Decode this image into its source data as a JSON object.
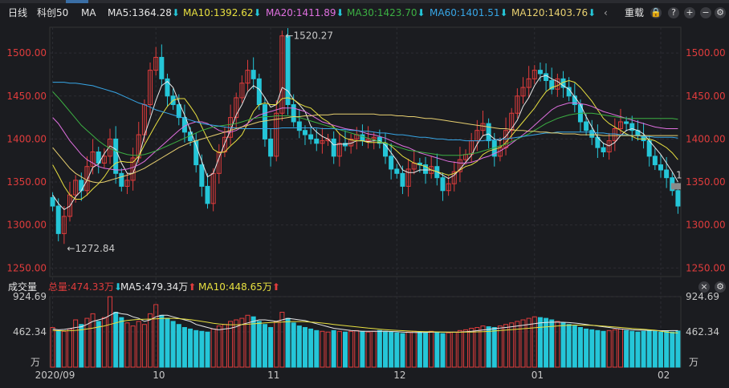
{
  "toolbar": {
    "period": "日线",
    "symbol": "科创50",
    "ma_label": "MA",
    "ma5": "MA5:1364.28",
    "ma10": "MA10:1392.62",
    "ma20": "MA20:1411.89",
    "ma30": "MA30:1423.70",
    "ma60": "MA60:1401.51",
    "ma120": "MA120:1403.76",
    "down_arrow": "⬇",
    "expand": "‹",
    "restore_label": "重载",
    "colors": {
      "ma5": "#e8e8e8",
      "ma10": "#e8e040",
      "ma20": "#e070e0",
      "ma30": "#3cb043",
      "ma60": "#37a6e6",
      "ma120": "#e8d070",
      "up": "#e03c3c",
      "down": "#25c6d8"
    }
  },
  "volume_bar": {
    "title": "成交量",
    "total": "总量:474.33万",
    "ma5": "MA5:479.34万",
    "ma10": "MA10:448.65万",
    "arrow_down": "⬇",
    "arrow_up": "⬆"
  },
  "chart_data": [
    {
      "type": "candlestick",
      "title": "科创50 日线",
      "y_ticks": [
        1250.0,
        1300.0,
        1350.0,
        1400.0,
        1450.0,
        1500.0
      ],
      "ylim": [
        1240,
        1530
      ],
      "annotations": [
        {
          "label": "←1520.27",
          "value": 1520.27
        },
        {
          "label": "←1272.84",
          "value": 1272.84
        }
      ],
      "right_marker": "1",
      "x_ticks": [
        "2020/09",
        "10",
        "11",
        "12",
        "01",
        "02"
      ],
      "x_tick_index": [
        0,
        18,
        38,
        60,
        84,
        106
      ],
      "closes": [
        1322,
        1290,
        1310,
        1335,
        1352,
        1340,
        1368,
        1385,
        1372,
        1380,
        1400,
        1360,
        1345,
        1352,
        1378,
        1405,
        1440,
        1480,
        1495,
        1470,
        1450,
        1440,
        1425,
        1408,
        1398,
        1370,
        1345,
        1325,
        1360,
        1385,
        1402,
        1425,
        1448,
        1465,
        1480,
        1470,
        1440,
        1400,
        1380,
        1430,
        1520,
        1440,
        1420,
        1410,
        1405,
        1400,
        1395,
        1398,
        1400,
        1380,
        1395,
        1392,
        1400,
        1405,
        1398,
        1400,
        1402,
        1395,
        1380,
        1365,
        1360,
        1345,
        1365,
        1372,
        1370,
        1360,
        1368,
        1355,
        1340,
        1348,
        1362,
        1376,
        1382,
        1398,
        1410,
        1418,
        1398,
        1380,
        1390,
        1410,
        1430,
        1450,
        1460,
        1470,
        1480,
        1476,
        1468,
        1458,
        1470,
        1460,
        1450,
        1440,
        1420,
        1410,
        1402,
        1390,
        1385,
        1398,
        1412,
        1420,
        1418,
        1410,
        1404,
        1398,
        1380,
        1370,
        1364,
        1355,
        1340,
        1322
      ],
      "ma_series": [
        {
          "name": "MA5",
          "values": [
            1335,
            1325,
            1318,
            1322,
            1333,
            1340,
            1352,
            1367,
            1371,
            1383,
            1392,
            1388,
            1372,
            1360,
            1360,
            1378,
            1404,
            1424,
            1445,
            1462,
            1467,
            1460,
            1443,
            1428,
            1410,
            1393,
            1374,
            1356,
            1360,
            1378,
            1395,
            1410,
            1428,
            1440,
            1455,
            1462,
            1458,
            1448,
            1437,
            1440,
            1460,
            1456,
            1446,
            1440,
            1432,
            1415,
            1408,
            1403,
            1400,
            1393,
            1394,
            1394,
            1395,
            1398,
            1398,
            1397,
            1398,
            1398,
            1393,
            1384,
            1375,
            1364,
            1361,
            1361,
            1364,
            1364,
            1364,
            1362,
            1358,
            1354,
            1358,
            1365,
            1373,
            1381,
            1394,
            1404,
            1406,
            1400,
            1398,
            1403,
            1412,
            1422,
            1438,
            1448,
            1462,
            1472,
            1474,
            1470,
            1467,
            1462,
            1458,
            1449,
            1440,
            1426,
            1414,
            1402,
            1395,
            1392,
            1396,
            1404,
            1410,
            1412,
            1410,
            1406,
            1398,
            1390,
            1382,
            1372,
            1362,
            1350
          ]
        },
        {
          "name": "MA10",
          "values": [
            1370,
            1358,
            1345,
            1335,
            1330,
            1330,
            1335,
            1342,
            1348,
            1356,
            1366,
            1372,
            1374,
            1373,
            1373,
            1380,
            1393,
            1405,
            1417,
            1428,
            1438,
            1445,
            1447,
            1447,
            1438,
            1428,
            1414,
            1400,
            1388,
            1384,
            1385,
            1392,
            1398,
            1405,
            1418,
            1432,
            1440,
            1442,
            1440,
            1440,
            1447,
            1448,
            1446,
            1441,
            1438,
            1436,
            1430,
            1424,
            1420,
            1414,
            1406,
            1401,
            1399,
            1398,
            1398,
            1396,
            1396,
            1396,
            1396,
            1392,
            1386,
            1380,
            1376,
            1372,
            1370,
            1368,
            1364,
            1362,
            1360,
            1358,
            1360,
            1364,
            1368,
            1370,
            1374,
            1382,
            1386,
            1388,
            1390,
            1396,
            1404,
            1412,
            1420,
            1428,
            1436,
            1446,
            1455,
            1460,
            1462,
            1466,
            1468,
            1466,
            1460,
            1452,
            1444,
            1434,
            1424,
            1418,
            1414,
            1410,
            1406,
            1403,
            1400,
            1400,
            1400,
            1398,
            1394,
            1390,
            1384,
            1376
          ]
        },
        {
          "name": "MA20",
          "values": [
            1425,
            1418,
            1408,
            1398,
            1390,
            1382,
            1376,
            1372,
            1368,
            1366,
            1365,
            1364,
            1364,
            1365,
            1367,
            1370,
            1374,
            1380,
            1386,
            1392,
            1398,
            1404,
            1410,
            1415,
            1418,
            1420,
            1420,
            1418,
            1414,
            1410,
            1408,
            1408,
            1410,
            1414,
            1418,
            1424,
            1428,
            1430,
            1432,
            1434,
            1436,
            1436,
            1436,
            1434,
            1432,
            1428,
            1424,
            1420,
            1418,
            1416,
            1414,
            1412,
            1411,
            1410,
            1408,
            1406,
            1405,
            1403,
            1401,
            1398,
            1395,
            1392,
            1390,
            1387,
            1384,
            1382,
            1380,
            1378,
            1376,
            1374,
            1373,
            1372,
            1372,
            1373,
            1375,
            1378,
            1380,
            1383,
            1386,
            1390,
            1395,
            1400,
            1405,
            1410,
            1416,
            1422,
            1428,
            1434,
            1438,
            1440,
            1442,
            1442,
            1441,
            1440,
            1438,
            1435,
            1432,
            1430,
            1428,
            1426,
            1424,
            1422,
            1420,
            1418,
            1416,
            1414,
            1413,
            1412,
            1412,
            1412
          ]
        },
        {
          "name": "MA30",
          "values": [
            1455,
            1448,
            1440,
            1432,
            1424,
            1416,
            1410,
            1404,
            1398,
            1393,
            1389,
            1386,
            1384,
            1382,
            1381,
            1381,
            1382,
            1384,
            1386,
            1389,
            1392,
            1395,
            1398,
            1401,
            1404,
            1407,
            1410,
            1412,
            1414,
            1415,
            1416,
            1417,
            1418,
            1420,
            1422,
            1424,
            1425,
            1426,
            1426,
            1427,
            1427,
            1427,
            1426,
            1425,
            1423,
            1421,
            1419,
            1417,
            1415,
            1413,
            1411,
            1409,
            1407,
            1405,
            1403,
            1401,
            1399,
            1397,
            1395,
            1393,
            1391,
            1389,
            1387,
            1386,
            1385,
            1384,
            1383,
            1382,
            1381,
            1381,
            1381,
            1381,
            1382,
            1383,
            1384,
            1386,
            1388,
            1390,
            1392,
            1394,
            1397,
            1400,
            1403,
            1406,
            1410,
            1414,
            1418,
            1421,
            1424,
            1426,
            1428,
            1429,
            1430,
            1430,
            1430,
            1429,
            1428,
            1427,
            1426,
            1425,
            1424,
            1424,
            1424,
            1424,
            1424,
            1424,
            1424,
            1424,
            1424,
            1423
          ]
        },
        {
          "name": "MA60",
          "values": [
            1466,
            1466,
            1466,
            1465,
            1465,
            1464,
            1463,
            1462,
            1460,
            1458,
            1456,
            1454,
            1451,
            1448,
            1445,
            1442,
            1440,
            1437,
            1434,
            1432,
            1430,
            1428,
            1426,
            1424,
            1422,
            1420,
            1418,
            1417,
            1416,
            1415,
            1414,
            1413,
            1413,
            1412,
            1412,
            1412,
            1412,
            1412,
            1412,
            1412,
            1413,
            1413,
            1413,
            1413,
            1413,
            1413,
            1413,
            1412,
            1412,
            1412,
            1411,
            1411,
            1410,
            1410,
            1409,
            1409,
            1408,
            1407,
            1407,
            1406,
            1405,
            1405,
            1404,
            1403,
            1402,
            1402,
            1401,
            1400,
            1400,
            1399,
            1399,
            1399,
            1398,
            1398,
            1398,
            1398,
            1399,
            1399,
            1400,
            1400,
            1401,
            1402,
            1403,
            1404,
            1405,
            1406,
            1407,
            1407,
            1408,
            1408,
            1408,
            1408,
            1408,
            1408,
            1408,
            1407,
            1407,
            1406,
            1406,
            1405,
            1405,
            1404,
            1404,
            1403,
            1403,
            1402,
            1402,
            1402,
            1402,
            1401
          ]
        },
        {
          "name": "MA120",
          "values": [
            1390,
            1382,
            1374,
            1366,
            1360,
            1356,
            1352,
            1350,
            1349,
            1350,
            1352,
            1354,
            1356,
            1358,
            1360,
            1363,
            1366,
            1370,
            1374,
            1378,
            1382,
            1386,
            1390,
            1393,
            1396,
            1398,
            1400,
            1402,
            1404,
            1406,
            1408,
            1410,
            1412,
            1414,
            1416,
            1418,
            1420,
            1421,
            1422,
            1423,
            1424,
            1425,
            1426,
            1426,
            1427,
            1427,
            1428,
            1428,
            1428,
            1429,
            1429,
            1429,
            1429,
            1429,
            1429,
            1429,
            1429,
            1428,
            1428,
            1428,
            1427,
            1427,
            1426,
            1426,
            1425,
            1424,
            1424,
            1423,
            1422,
            1421,
            1420,
            1419,
            1418,
            1417,
            1416,
            1415,
            1414,
            1413,
            1412,
            1412,
            1411,
            1410,
            1410,
            1409,
            1409,
            1408,
            1408,
            1407,
            1407,
            1406,
            1406,
            1406,
            1405,
            1405,
            1405,
            1405,
            1404,
            1404,
            1404,
            1404,
            1404,
            1404,
            1404,
            1404,
            1404,
            1404,
            1404,
            1404,
            1404,
            1404
          ]
        }
      ]
    },
    {
      "type": "bar",
      "title": "成交量",
      "y_ticks_labels": [
        "924.69",
        "462.34",
        "万"
      ],
      "y_ticks": [
        924.69,
        462.34
      ],
      "ylim": [
        0,
        924.69
      ],
      "values": [
        520,
        480,
        470,
        500,
        620,
        560,
        640,
        700,
        600,
        650,
        924,
        720,
        650,
        580,
        540,
        600,
        560,
        700,
        820,
        680,
        640,
        600,
        560,
        520,
        500,
        480,
        470,
        460,
        500,
        540,
        560,
        600,
        620,
        640,
        680,
        660,
        600,
        560,
        520,
        600,
        720,
        640,
        580,
        540,
        520,
        500,
        480,
        470,
        460,
        480,
        470,
        460,
        470,
        480,
        470,
        460,
        470,
        480,
        470,
        460,
        450,
        440,
        460,
        470,
        460,
        450,
        470,
        460,
        440,
        450,
        460,
        480,
        490,
        510,
        520,
        540,
        530,
        520,
        540,
        560,
        580,
        600,
        620,
        640,
        660,
        650,
        640,
        620,
        600,
        580,
        560,
        540,
        520,
        500,
        490,
        480,
        470,
        480,
        490,
        500,
        480,
        470,
        460,
        470,
        480,
        470,
        460,
        470,
        460,
        474
      ],
      "ma5": [
        500,
        490,
        495,
        505,
        520,
        530,
        560,
        600,
        620,
        640,
        680,
        720,
        700,
        690,
        660,
        640,
        600,
        620,
        660,
        680,
        680,
        660,
        640,
        620,
        600,
        560,
        540,
        520,
        500,
        490,
        500,
        510,
        530,
        560,
        580,
        600,
        620,
        620,
        610,
        600,
        620,
        640,
        630,
        620,
        610,
        590,
        570,
        550,
        530,
        510,
        500,
        490,
        480,
        475,
        470,
        470,
        470,
        472,
        470,
        468,
        465,
        460,
        456,
        455,
        455,
        456,
        458,
        460,
        460,
        458,
        458,
        460,
        465,
        470,
        478,
        488,
        495,
        505,
        512,
        520,
        530,
        540,
        550,
        560,
        570,
        580,
        585,
        590,
        590,
        588,
        584,
        578,
        570,
        560,
        550,
        540,
        530,
        520,
        510,
        500,
        495,
        490,
        486,
        484,
        482,
        480,
        478,
        478,
        479,
        479
      ],
      "ma10": [
        480,
        478,
        476,
        478,
        482,
        490,
        500,
        512,
        526,
        540,
        560,
        580,
        600,
        612,
        620,
        626,
        628,
        630,
        634,
        638,
        640,
        640,
        636,
        630,
        622,
        612,
        600,
        588,
        576,
        566,
        560,
        556,
        556,
        558,
        562,
        568,
        574,
        580,
        584,
        588,
        592,
        596,
        598,
        598,
        596,
        592,
        586,
        578,
        570,
        560,
        552,
        544,
        536,
        528,
        520,
        512,
        505,
        498,
        492,
        486,
        482,
        478,
        474,
        471,
        468,
        466,
        464,
        462,
        460,
        459,
        458,
        458,
        459,
        460,
        462,
        465,
        469,
        474,
        480,
        486,
        492,
        498,
        504,
        510,
        516,
        522,
        528,
        534,
        540,
        545,
        550,
        552,
        552,
        550,
        548,
        544,
        538,
        532,
        526,
        520,
        514,
        508,
        502,
        496,
        490,
        484,
        472,
        460,
        452,
        449
      ]
    }
  ]
}
